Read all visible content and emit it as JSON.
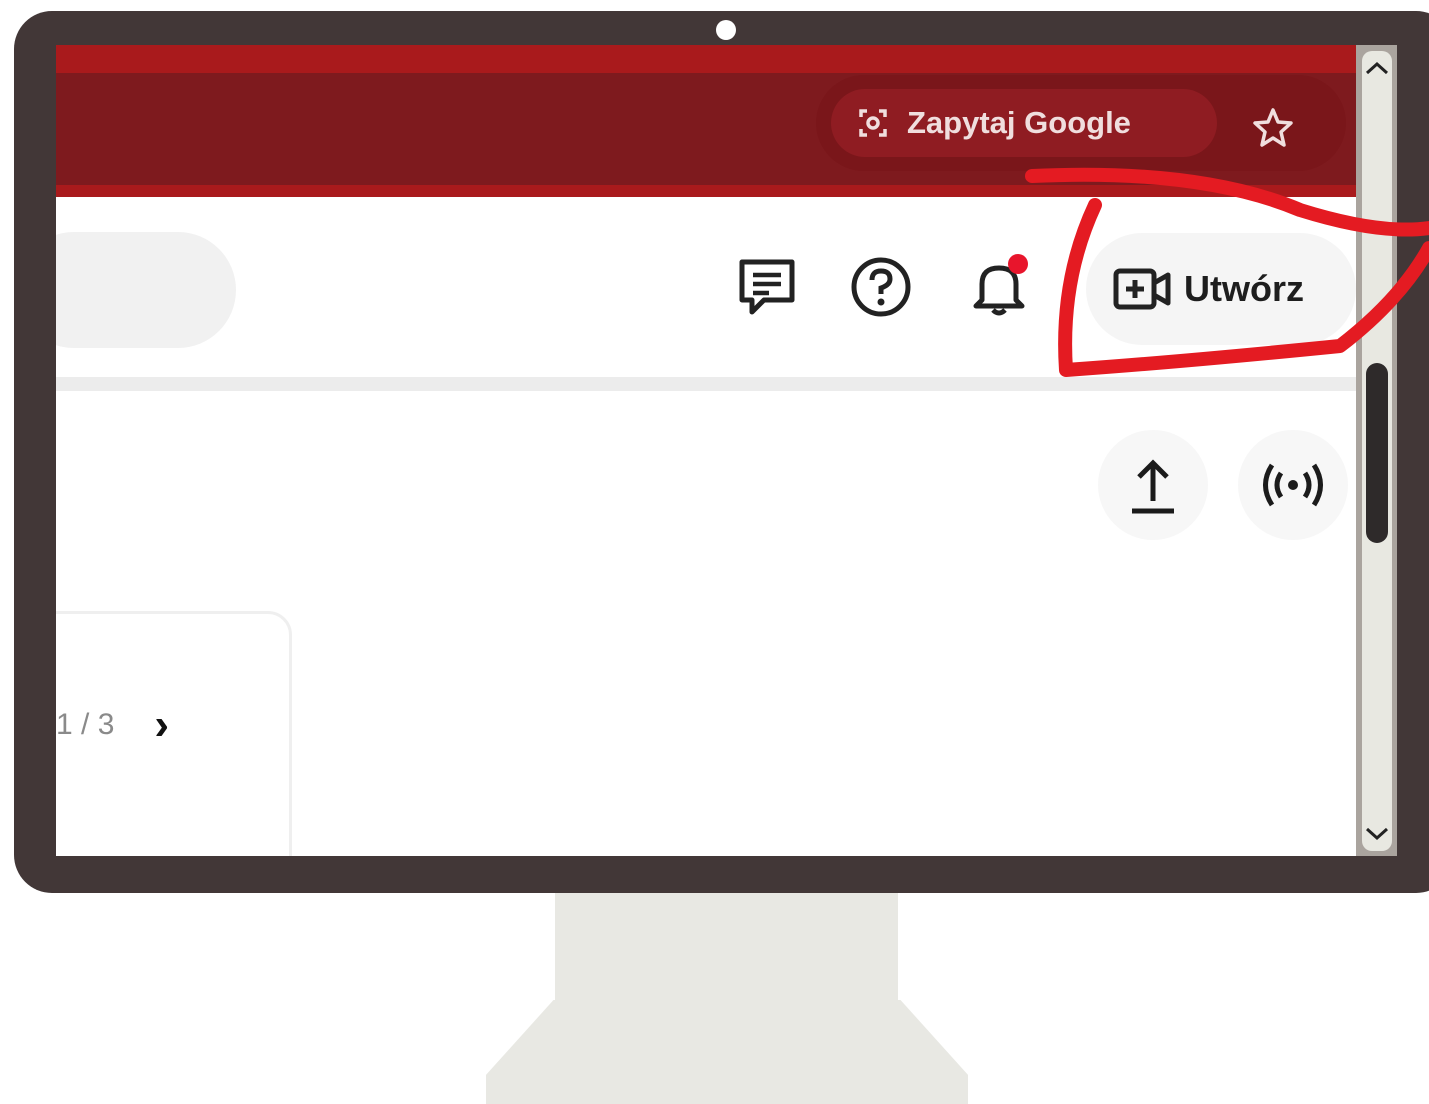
{
  "browser": {
    "ask_google_label": "Zapytaj Google",
    "accent_color": "#a91a1c"
  },
  "header": {
    "create_label": "Utwórz",
    "icons": [
      "feedback-icon",
      "help-icon",
      "notifications-icon",
      "create-video-icon"
    ],
    "notification_dot_color": "#e8152c"
  },
  "main": {
    "actions": [
      "upload-icon",
      "live-broadcast-icon"
    ],
    "pager": {
      "text": "1 / 3"
    }
  },
  "annotation": {
    "color": "#e41b22"
  }
}
